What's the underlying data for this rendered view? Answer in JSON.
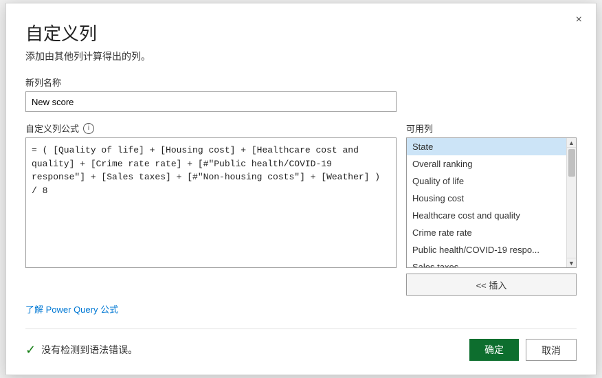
{
  "dialog": {
    "title": "自定义列",
    "subtitle": "添加由其他列计算得出的列。",
    "close_label": "×",
    "new_column_label": "新列名称",
    "new_column_value": "New score",
    "formula_label": "自定义列公式",
    "formula_content": "= ( [Quality of life] + [Housing cost] + [Healthcare cost and quality] + [Crime rate rate] + [#\"Public health/COVID-19 response\"] + [Sales taxes] + [#\"Non-housing costs\"] + [Weather] ) / 8",
    "available_label": "可用列",
    "columns": [
      "State",
      "Overall ranking",
      "Quality of life",
      "Housing cost",
      "Healthcare cost and quality",
      "Crime rate rate",
      "Public health/COVID-19 respo...",
      "Sales taxes"
    ],
    "selected_column": "State",
    "insert_btn_label": "<< 插入",
    "learn_link": "了解 Power Query 公式",
    "validation_text": "没有检测到语法错误。",
    "ok_label": "确定",
    "cancel_label": "取消"
  }
}
